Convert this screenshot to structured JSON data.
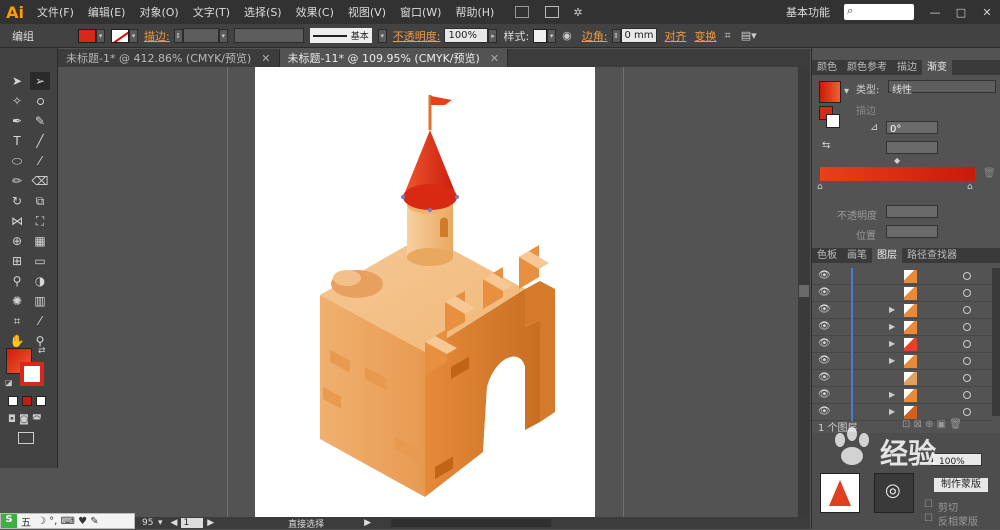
{
  "app": {
    "logo": "Ai",
    "workspace": "基本功能",
    "search_placeholder": ""
  },
  "menu": [
    "文件(F)",
    "编辑(E)",
    "对象(O)",
    "文字(T)",
    "选择(S)",
    "效果(C)",
    "视图(V)",
    "窗口(W)",
    "帮助(H)"
  ],
  "window_controls": {
    "minimize": "—",
    "maximize": "□",
    "close": "✕"
  },
  "control_bar": {
    "selection_label": "编组",
    "stroke_label": "描边:",
    "stroke_profile": "基本",
    "opacity_label": "不透明度:",
    "opacity_value": "100%",
    "style_label": "样式:",
    "corner_label": "边角:",
    "corner_value": "0 mm",
    "align_label": "对齐",
    "transform_label": "变换"
  },
  "tabs": [
    {
      "label": "未标题-1* @ 412.86% (CMYK/预览)",
      "close": "✕",
      "active": false
    },
    {
      "label": "未标题-11* @ 109.95% (CMYK/预览)",
      "close": "✕",
      "active": true
    }
  ],
  "status": {
    "zoom": "95",
    "page": "1",
    "tool": "直接选择"
  },
  "panel_top": {
    "tabs": [
      "颜色",
      "颜色参考",
      "描边",
      "渐变"
    ],
    "active_tab": "渐变",
    "type_label": "类型:",
    "type_value": "线性",
    "stroke_label": "描边",
    "angle_value": "0°",
    "opacity_label": "不透明度",
    "position_label": "位置"
  },
  "panel_layers": {
    "tabs": [
      "色板",
      "画笔",
      "图层",
      "路径查找器"
    ],
    "active_tab": "图层",
    "footer": "1 个图层"
  },
  "layer_rows": [
    {
      "expand": "",
      "thumb": "#e88a3a"
    },
    {
      "expand": "",
      "thumb": "#e88a3a"
    },
    {
      "expand": "▶",
      "thumb": "#e88a3a"
    },
    {
      "expand": "▶",
      "thumb": "#e88a3a"
    },
    {
      "expand": "▶",
      "thumb": "#e8402a"
    },
    {
      "expand": "▶",
      "thumb": "#e88a3a"
    },
    {
      "expand": "",
      "thumb": "#e0a060"
    },
    {
      "expand": "▶",
      "thumb": "#e88a3a"
    },
    {
      "expand": "▶",
      "thumb": "#d0601a"
    }
  ],
  "bottom_panel": {
    "opacity_value": "100%",
    "mask_button": "制作蒙版",
    "clip_label": "剪切",
    "invert_label": "反相蒙版"
  },
  "watermark": "经验",
  "taskbar": {
    "ime": "五",
    "symbols": "☽ °, ⌨ ♥ ✎"
  },
  "colors": {
    "fill_gradient_start": "#cc1a0a",
    "fill_gradient_end": "#f06030",
    "castle_light": "#f3c08a",
    "castle_mid": "#e89a50",
    "castle_dark": "#c86e22",
    "roof": "#e0401e",
    "flag": "#e8401a",
    "guide": "#c94a4a"
  }
}
